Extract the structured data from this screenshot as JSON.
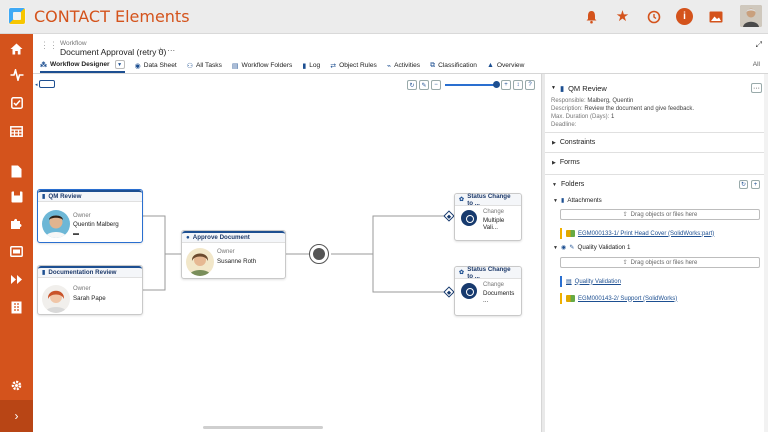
{
  "app": {
    "title": "CONTACT Elements",
    "colors": {
      "brand": "#d4531c",
      "accent": "#1d4f91",
      "nav_bg": "#d4531c"
    },
    "top_icons": [
      "bell-icon",
      "star-icon",
      "history-icon",
      "info-icon",
      "image-icon"
    ]
  },
  "nav": {
    "items": [
      "home-icon",
      "activity-icon",
      "checklist-icon",
      "table-icon",
      "document-icon",
      "folder-icon",
      "puzzle-icon",
      "card-icon",
      "forward-icon",
      "building-icon",
      "settings-icon"
    ]
  },
  "header": {
    "breadcrumb": "Workflow",
    "title": "Document Approval (retry 0)",
    "star": "☆",
    "more": "···"
  },
  "tabs": [
    {
      "label": "Workflow Designer",
      "icon": "workflow-icon",
      "active": true
    },
    {
      "label": "Data Sheet",
      "icon": "datasheet-icon"
    },
    {
      "label": "All Tasks",
      "icon": "tasks-icon"
    },
    {
      "label": "Workflow Folders",
      "icon": "folders-icon"
    },
    {
      "label": "Log",
      "icon": "log-icon"
    },
    {
      "label": "Object Rules",
      "icon": "rules-icon"
    },
    {
      "label": "Activities",
      "icon": "activities-icon"
    },
    {
      "label": "Classification",
      "icon": "classification-icon"
    },
    {
      "label": "Overview",
      "icon": "overview-icon"
    }
  ],
  "tabs_all": "All",
  "canvas": {
    "tasks": [
      {
        "title": "QM Review",
        "role": "Owner",
        "person": "Quentin Malberg",
        "selected": true
      },
      {
        "title": "Documentation Review",
        "role": "Owner",
        "person": "Sarah Pape"
      },
      {
        "title": "Approve Document",
        "role": "Owner",
        "person": "Susanne Roth"
      }
    ],
    "status_cards": [
      {
        "title": "Status Change to ...",
        "role": "Change",
        "value": "Multiple Vali..."
      },
      {
        "title": "Status Change to ...",
        "role": "Change",
        "value": "Documents ..."
      }
    ]
  },
  "panel": {
    "title": "QM Review",
    "fields": [
      {
        "key": "Responsible:",
        "value": "Malberg, Quentin"
      },
      {
        "key": "Description:",
        "value": "Review the document and give feedback."
      },
      {
        "key": "Max. Duration (Days):",
        "value": "1"
      },
      {
        "key": "Deadline:",
        "value": ""
      }
    ],
    "sections": {
      "constraints": "Constraints",
      "forms": "Forms",
      "folders": "Folders"
    },
    "attachments_label": "Attachments",
    "drop_text": "Drag objects or files here",
    "attachment_link": "EGM000133-1/ Print Head Cover (SolidWorks:part)",
    "quality_label": "Quality Validation 1",
    "quality_link": "Quality Validation",
    "support_link": "EGM000143-2/ Support (SolidWorks)"
  }
}
